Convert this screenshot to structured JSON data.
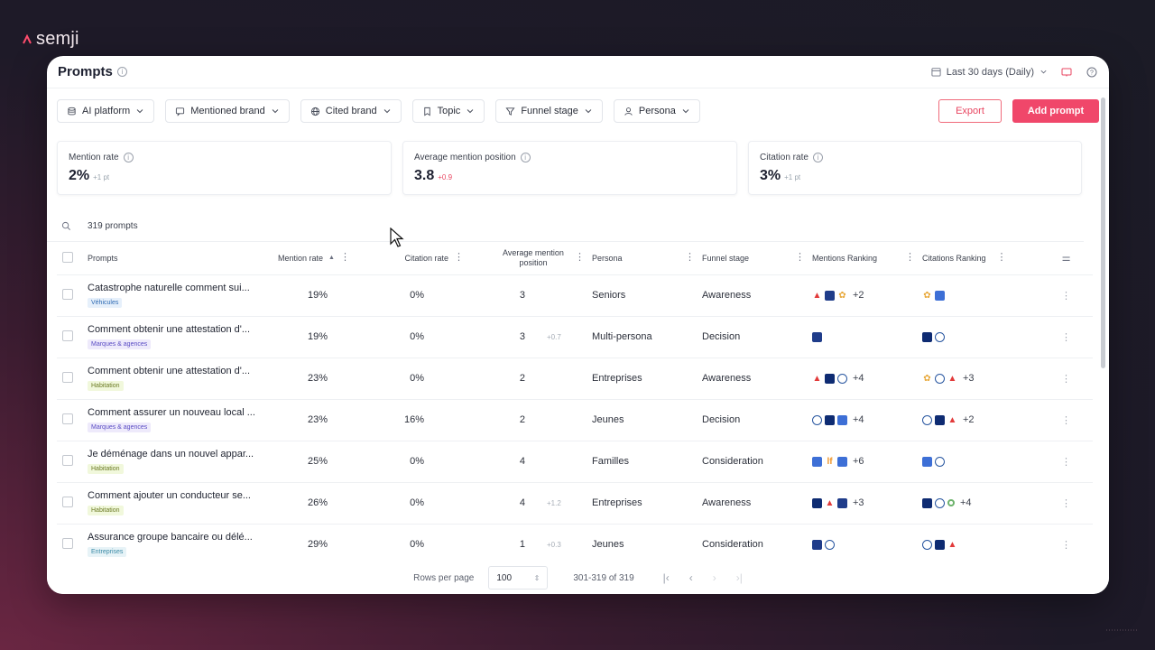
{
  "brand": {
    "name": "semji"
  },
  "header": {
    "title": "Prompts",
    "date_range": "Last 30 days (Daily)"
  },
  "filters": [
    {
      "label": "AI platform",
      "icon": "database-icon"
    },
    {
      "label": "Mentioned brand",
      "icon": "chat-icon"
    },
    {
      "label": "Cited brand",
      "icon": "globe-icon"
    },
    {
      "label": "Topic",
      "icon": "bookmark-icon"
    },
    {
      "label": "Funnel stage",
      "icon": "funnel-icon"
    },
    {
      "label": "Persona",
      "icon": "user-icon"
    }
  ],
  "actions": {
    "export": "Export",
    "add": "Add prompt"
  },
  "metrics": [
    {
      "label": "Mention rate",
      "value": "2%",
      "delta": "+1 pt"
    },
    {
      "label": "Average mention position",
      "value": "3.8",
      "delta": "+0.9"
    },
    {
      "label": "Citation rate",
      "value": "3%",
      "delta": "+1 pt"
    }
  ],
  "search": {
    "count": "319 prompts"
  },
  "columns": {
    "prompts": "Prompts",
    "mention_rate": "Mention rate",
    "citation_rate": "Citation rate",
    "avg_position": "Average mention position",
    "persona": "Persona",
    "funnel": "Funnel stage",
    "mentions_ranking": "Mentions Ranking",
    "citations_ranking": "Citations Ranking"
  },
  "rows": [
    {
      "prompt": "Catastrophe naturelle comment sui...",
      "tag": "Véhicules",
      "mention": "19%",
      "citation": "0%",
      "position": "3",
      "pos_delta": "",
      "persona": "Seniors",
      "funnel": "Awareness",
      "mentions_more": "+2",
      "citations_more": ""
    },
    {
      "prompt": "Comment obtenir une attestation d'...",
      "tag": "Marques & agences",
      "mention": "19%",
      "citation": "0%",
      "position": "3",
      "pos_delta": "+0.7",
      "persona": "Multi-persona",
      "funnel": "Decision",
      "mentions_more": "",
      "citations_more": ""
    },
    {
      "prompt": "Comment obtenir une attestation d'...",
      "tag": "Habitation",
      "mention": "23%",
      "citation": "0%",
      "position": "2",
      "pos_delta": "",
      "persona": "Entreprises",
      "funnel": "Awareness",
      "mentions_more": "+4",
      "citations_more": "+3"
    },
    {
      "prompt": "Comment assurer un nouveau local ...",
      "tag": "Marques & agences",
      "mention": "23%",
      "citation": "16%",
      "position": "2",
      "pos_delta": "",
      "persona": "Jeunes",
      "funnel": "Decision",
      "mentions_more": "+4",
      "citations_more": "+2"
    },
    {
      "prompt": "Je déménage dans un nouvel appar...",
      "tag": "Habitation",
      "mention": "25%",
      "citation": "0%",
      "position": "4",
      "pos_delta": "",
      "persona": "Familles",
      "funnel": "Consideration",
      "mentions_more": "+6",
      "citations_more": ""
    },
    {
      "prompt": "Comment ajouter un conducteur se...",
      "tag": "Habitation",
      "mention": "26%",
      "citation": "0%",
      "position": "4",
      "pos_delta": "+1.2",
      "persona": "Entreprises",
      "funnel": "Awareness",
      "mentions_more": "+3",
      "citations_more": "+4"
    },
    {
      "prompt": "Assurance groupe bancaire ou délé...",
      "tag": "Entreprises",
      "mention": "29%",
      "citation": "0%",
      "position": "1",
      "pos_delta": "+0.3",
      "persona": "Jeunes",
      "funnel": "Consideration",
      "mentions_more": "",
      "citations_more": ""
    }
  ],
  "tag_colors": {
    "Véhicules": {
      "bg": "#e6f0fb",
      "fg": "#2f6bb3"
    },
    "Marques & agences": {
      "bg": "#eeeafb",
      "fg": "#5a4cc4"
    },
    "Habitation": {
      "bg": "#f1f8dc",
      "fg": "#6b7a23"
    },
    "Entreprises": {
      "bg": "#e7f3f7",
      "fg": "#3a8aa6"
    }
  },
  "pagination": {
    "rows_label": "Rows per page",
    "rows_value": "100",
    "range": "301-319 of 319"
  }
}
